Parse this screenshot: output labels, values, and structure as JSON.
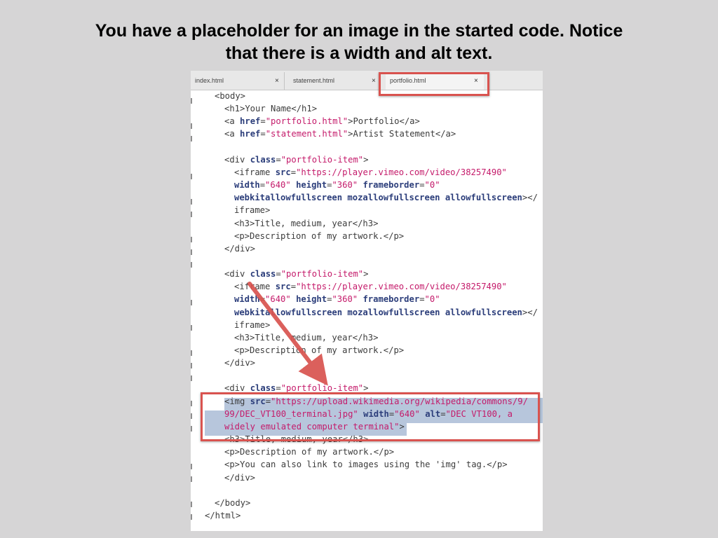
{
  "slide": {
    "title_line1": "You have a placeholder for an image in the started code. Notice",
    "title_line2": "that there is a width and alt text."
  },
  "colors": {
    "background": "#d6d5d6",
    "highlight": "#d9534f",
    "selection": "#b7c6dc",
    "string": "#c41a6a",
    "attribute": "#2b3d7a"
  },
  "tabs": [
    {
      "label": "index.html",
      "close": "×",
      "active": false
    },
    {
      "label": "statement.html",
      "close": "×",
      "active": false
    },
    {
      "label": "portfolio.html",
      "close": "×",
      "active": true
    }
  ],
  "code_lines": [
    [
      [
        "t",
        "<body>"
      ]
    ],
    [
      [
        "t",
        "<h1>Your Name</h1>"
      ]
    ],
    [
      [
        "t",
        "<a "
      ],
      [
        "a",
        "href"
      ],
      [
        "t",
        "="
      ],
      [
        "s",
        "\"portfolio.html\""
      ],
      [
        "t",
        ">Portfolio</a>"
      ]
    ],
    [
      [
        "t",
        "<a "
      ],
      [
        "a",
        "href"
      ],
      [
        "t",
        "="
      ],
      [
        "s",
        "\"statement.html\""
      ],
      [
        "t",
        ">Artist Statement</a>"
      ]
    ],
    [],
    [
      [
        "t",
        "<div "
      ],
      [
        "a",
        "class"
      ],
      [
        "t",
        "="
      ],
      [
        "s",
        "\"portfolio-item\""
      ],
      [
        "t",
        ">"
      ]
    ],
    [
      [
        "t",
        "<iframe "
      ],
      [
        "a",
        "src"
      ],
      [
        "t",
        "="
      ],
      [
        "s",
        "\"https://player.vimeo.com/video/38257490\""
      ]
    ],
    [
      [
        "a",
        "width"
      ],
      [
        "t",
        "="
      ],
      [
        "s",
        "\"640\""
      ],
      [
        "t",
        " "
      ],
      [
        "a",
        "height"
      ],
      [
        "t",
        "="
      ],
      [
        "s",
        "\"360\""
      ],
      [
        "t",
        " "
      ],
      [
        "a",
        "frameborder"
      ],
      [
        "t",
        "="
      ],
      [
        "s",
        "\"0\""
      ]
    ],
    [
      [
        "a",
        "webkitallowfullscreen mozallowfullscreen allowfullscreen"
      ],
      [
        "t",
        "></"
      ]
    ],
    [
      [
        "t",
        "iframe>"
      ]
    ],
    [
      [
        "t",
        "<h3>Title, medium, year</h3>"
      ]
    ],
    [
      [
        "t",
        "<p>Description of my artwork.</p>"
      ]
    ],
    [
      [
        "t",
        "</div>"
      ]
    ],
    [],
    [
      [
        "t",
        "<div "
      ],
      [
        "a",
        "class"
      ],
      [
        "t",
        "="
      ],
      [
        "s",
        "\"portfolio-item\""
      ],
      [
        "t",
        ">"
      ]
    ],
    [
      [
        "t",
        "<iframe "
      ],
      [
        "a",
        "src"
      ],
      [
        "t",
        "="
      ],
      [
        "s",
        "\"https://player.vimeo.com/video/38257490\""
      ]
    ],
    [
      [
        "a",
        "width"
      ],
      [
        "t",
        "="
      ],
      [
        "s",
        "\"640\""
      ],
      [
        "t",
        " "
      ],
      [
        "a",
        "height"
      ],
      [
        "t",
        "="
      ],
      [
        "s",
        "\"360\""
      ],
      [
        "t",
        " "
      ],
      [
        "a",
        "frameborder"
      ],
      [
        "t",
        "="
      ],
      [
        "s",
        "\"0\""
      ]
    ],
    [
      [
        "a",
        "webkitallowfullscreen mozallowfullscreen allowfullscreen"
      ],
      [
        "t",
        "></"
      ]
    ],
    [
      [
        "t",
        "iframe>"
      ]
    ],
    [
      [
        "t",
        "<h3>Title, medium, year</h3>"
      ]
    ],
    [
      [
        "t",
        "<p>Description of my artwork.</p>"
      ]
    ],
    [
      [
        "t",
        "</div>"
      ]
    ],
    [],
    [
      [
        "t",
        "<div "
      ],
      [
        "a",
        "class"
      ],
      [
        "t",
        "="
      ],
      [
        "s",
        "\"portfolio-item\""
      ],
      [
        "t",
        ">"
      ]
    ],
    [
      [
        "t",
        "<img "
      ],
      [
        "a",
        "src"
      ],
      [
        "t",
        "="
      ],
      [
        "s",
        "\"https://upload.wikimedia.org/wikipedia/commons/9/"
      ]
    ],
    [
      [
        "s",
        "99/DEC_VT100_terminal.jpg\""
      ],
      [
        "t",
        " "
      ],
      [
        "a",
        "width"
      ],
      [
        "t",
        "="
      ],
      [
        "s",
        "\"640\""
      ],
      [
        "t",
        " "
      ],
      [
        "a",
        "alt"
      ],
      [
        "t",
        "="
      ],
      [
        "s",
        "\"DEC VT100, a"
      ]
    ],
    [
      [
        "s",
        "widely emulated computer terminal\""
      ],
      [
        "t",
        ">"
      ]
    ],
    [
      [
        "t",
        "<h3>Title, medium, year</h3>"
      ]
    ],
    [
      [
        "t",
        "<p>Description of my artwork.</p>"
      ]
    ],
    [
      [
        "t",
        "<p>You can also link to images using the 'img' tag.</p>"
      ]
    ],
    [
      [
        "t",
        "</div>"
      ]
    ],
    [],
    [
      [
        "t",
        "</body>"
      ]
    ],
    [
      [
        "t",
        "</html>"
      ]
    ]
  ]
}
